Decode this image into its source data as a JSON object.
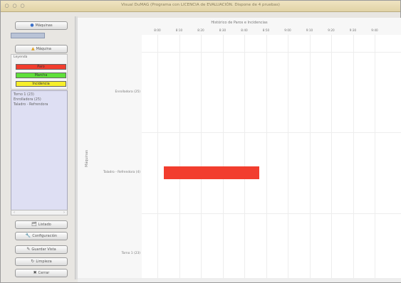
{
  "window": {
    "title": "Visual DuMAG (Programa con LICENCIA de EVALUACIÓN. Dispone de 4 pruebas)",
    "controls": [
      "○",
      "○",
      "○"
    ]
  },
  "sidebar": {
    "maquinas_label": "Máquinas",
    "maquina_label": "Máquina",
    "leyenda_title": "Leyenda",
    "legend": [
      {
        "label": "Paro",
        "color": "#f23d2e"
      },
      {
        "label": "Marcha",
        "color": "#5fe03a"
      },
      {
        "label": "Incidencia",
        "color": "#f7ef2b"
      }
    ],
    "list_items": [
      "Torno 1 (23)",
      "Enrolladora (25)",
      "Taladro - Refrendora"
    ],
    "buttons": [
      {
        "label": "Listado",
        "icon": "🗂"
      },
      {
        "label": "Configuración",
        "icon": "🔧"
      },
      {
        "label": "Guardar Vista",
        "icon": "✎"
      },
      {
        "label": "Limpieza",
        "icon": "↻"
      },
      {
        "label": "Cerrar",
        "icon": "✖"
      }
    ]
  },
  "chart_data": {
    "type": "gantt",
    "title": "Histórico de Paros e Incidencias",
    "ylabel": "Máquinas",
    "xticks": [
      "8:00",
      "8:10",
      "8:20",
      "8:30",
      "8:40",
      "8:50",
      "9:00",
      "9:10",
      "9:20",
      "9:30",
      "9:40"
    ],
    "categories": [
      "Enrolladora (25)",
      "Taladro - Refrendora (4)",
      "Torno 1 (23)"
    ],
    "bars": [
      {
        "category": "Taladro - Refrendora (4)",
        "start": "8:03",
        "end": "8:47",
        "state": "Paro",
        "color": "#f23d2e"
      }
    ],
    "colors": {
      "paro": "#f23d2e",
      "marcha": "#5fe03a",
      "incidencia": "#f7ef2b"
    }
  }
}
